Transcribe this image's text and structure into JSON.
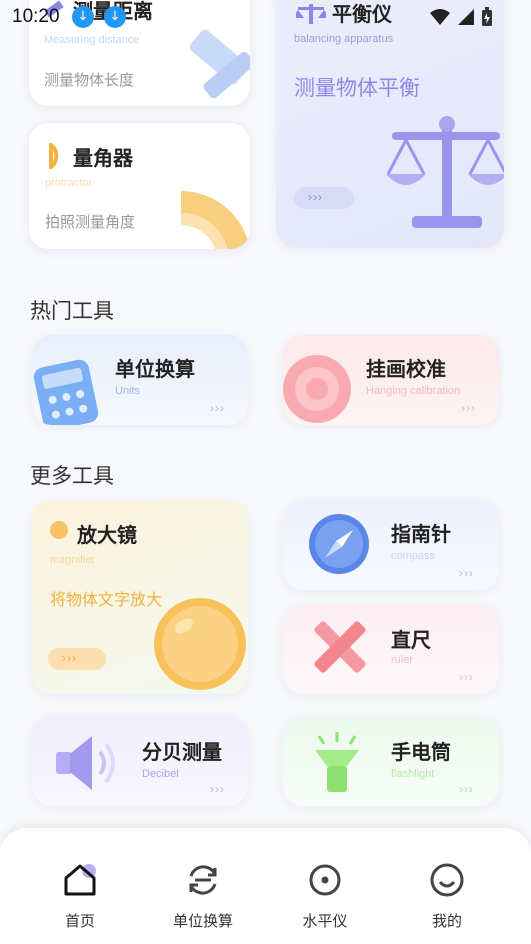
{
  "status_bar": {
    "time": "10:20"
  },
  "cards": {
    "measure_distance": {
      "title": "测量距离",
      "subtitle": "Measuring distance",
      "desc": "测量物体长度"
    },
    "balance": {
      "title": "平衡仪",
      "subtitle": "balancing apparatus",
      "desc": "测量物体平衡",
      "arrows": "›››"
    },
    "protractor": {
      "title": "量角器",
      "subtitle": "protractor",
      "desc": "拍照测量角度"
    }
  },
  "sections": {
    "hot_tools": "热门工具",
    "more_tools": "更多工具"
  },
  "hot_tools": {
    "units": {
      "title": "单位换算",
      "subtitle": "Units",
      "arrows": "›››"
    },
    "hanging": {
      "title": "挂画校准",
      "subtitle": "Hanging calibration",
      "arrows": "›››"
    }
  },
  "more_tools": {
    "magnifier": {
      "title": "放大镜",
      "subtitle": "magnifier",
      "desc": "将物体文字放大",
      "arrows": "›››"
    },
    "compass": {
      "title": "指南针",
      "subtitle": "compass",
      "arrows": "›››"
    },
    "ruler": {
      "title": "直尺",
      "subtitle": "ruler",
      "arrows": "›››"
    },
    "decibel": {
      "title": "分贝测量",
      "subtitle": "Decibel",
      "arrows": "›››"
    },
    "flashlight": {
      "title": "手电筒",
      "subtitle": "flashlight",
      "arrows": "›››"
    }
  },
  "nav": {
    "home": "首页",
    "units": "单位换算",
    "level": "水平仪",
    "mine": "我的"
  },
  "colors": {
    "accent_purple": "#8e87ea",
    "accent_blue": "#4a7dea",
    "accent_orange": "#f2b13d"
  }
}
